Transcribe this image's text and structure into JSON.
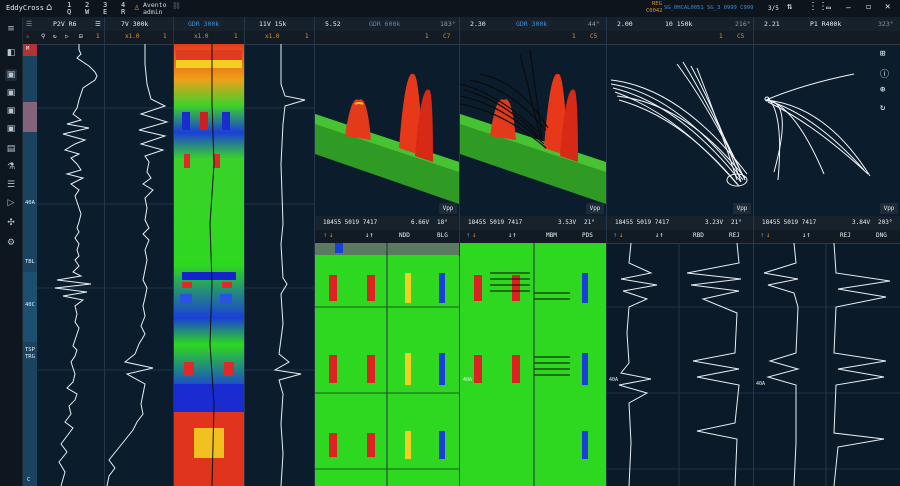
{
  "app": {
    "name": "EddyCross",
    "user": "Avento",
    "role": "admin",
    "shortcuts": [
      {
        "num": "1",
        "key": "Q"
      },
      {
        "num": "2",
        "key": "W"
      },
      {
        "num": "3",
        "key": "E"
      },
      {
        "num": "4",
        "key": "R"
      }
    ],
    "status": {
      "reg_top": "REG",
      "reg_bottom": "C0042",
      "path": "SG_0HCAL0051 SG_3 0999 C999",
      "page": "3/5"
    }
  },
  "sidebar": {
    "icons": [
      "menu-icon",
      "display-icon",
      "sidebar-a-icon",
      "sidebar-b-icon",
      "sidebar-c-icon",
      "sidebar-d-icon",
      "clipboard-icon",
      "flask-icon",
      "list-icon",
      "play-icon",
      "star-icon",
      "settings-icon"
    ]
  },
  "strips": [
    {
      "name": "P2V R6",
      "sub_left": "?",
      "sub_right": "1"
    },
    {
      "name": "7V  300k",
      "sub_left": "",
      "sub_mid": "x1.0",
      "sub_right": "1"
    },
    {
      "name": "GDR 300k",
      "sub_left": "",
      "sub_mid": "x1.0",
      "sub_right": "1"
    },
    {
      "name": "11V  15k",
      "sub_left": "",
      "sub_mid": "x1.0",
      "sub_right": "1"
    }
  ],
  "depth_labels": [
    "M",
    "40A",
    "TBL",
    "40C",
    "TSP",
    "TRG",
    "C"
  ],
  "views": [
    {
      "left": "5.52",
      "center": "GDR 600k",
      "angle": "183°",
      "sub_a": "1",
      "sub_b": "C7"
    },
    {
      "left": "2.30",
      "center": "GDR 300k",
      "angle": "44°",
      "sub_a": "1",
      "sub_b": "C5"
    },
    {
      "left": "2.00",
      "center": "10  150k",
      "angle": "216°",
      "sub_a": "1",
      "sub_b": "C5"
    },
    {
      "left": "2.21",
      "center": "P1  R400k",
      "angle": "323°",
      "sub_a": "",
      "sub_b": ""
    }
  ],
  "vpp_label": "Vpp",
  "lower": [
    {
      "coords": "18455  5019  7417",
      "left_label": "NDD",
      "voltage": "6.66V",
      "deg": "18°",
      "right_label": "BLG"
    },
    {
      "coords": "18455  5019  7417",
      "left_label": "MBM",
      "voltage": "3.53V",
      "deg": "21°",
      "right_label": "PDS"
    },
    {
      "coords": "18455  5019  7417",
      "left_label": "RBD",
      "voltage": "3.23V",
      "deg": "21°",
      "right_label": "REJ"
    },
    {
      "coords": "18455  5019  7417",
      "left_label": "REJ",
      "voltage": "3.84V",
      "deg": "203°",
      "right_label": "DNG"
    }
  ],
  "lower_marker": "40A"
}
